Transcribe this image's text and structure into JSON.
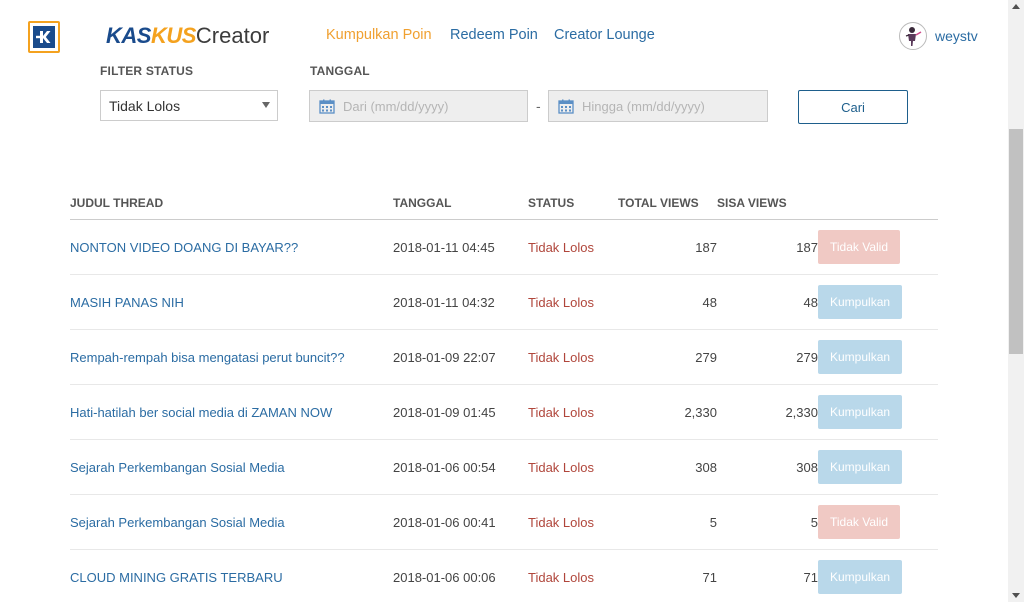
{
  "header": {
    "brand_kas": "KAS",
    "brand_kus": "KUS",
    "brand_creator": "Creator",
    "nav": [
      {
        "label": "Kumpulkan Poin",
        "active": true
      },
      {
        "label": "Redeem Poin",
        "active": false
      },
      {
        "label": "Creator Lounge",
        "active": false
      }
    ],
    "username": "weystv"
  },
  "filter": {
    "status_label": "FILTER STATUS",
    "date_label": "TANGGAL",
    "status_value": "Tidak Lolos",
    "from_placeholder": "Dari (mm/dd/yyyy)",
    "to_placeholder": "Hingga (mm/dd/yyyy)",
    "range_separator": "-",
    "search_label": "Cari"
  },
  "table": {
    "columns": [
      "JUDUL THREAD",
      "TANGGAL",
      "STATUS",
      "TOTAL VIEWS",
      "SISA VIEWS"
    ],
    "rows": [
      {
        "title": "NONTON VIDEO DOANG DI BAYAR??",
        "date": "2018-01-11 04:45",
        "status": "Tidak Lolos",
        "total": "187",
        "sisa": "187",
        "action": "Tidak Valid",
        "action_type": "invalid"
      },
      {
        "title": "MASIH PANAS NIH",
        "date": "2018-01-11 04:32",
        "status": "Tidak Lolos",
        "total": "48",
        "sisa": "48",
        "action": "Kumpulkan",
        "action_type": "collect"
      },
      {
        "title": "Rempah-rempah bisa mengatasi perut buncit??",
        "date": "2018-01-09 22:07",
        "status": "Tidak Lolos",
        "total": "279",
        "sisa": "279",
        "action": "Kumpulkan",
        "action_type": "collect"
      },
      {
        "title": "Hati-hatilah ber social media di ZAMAN NOW",
        "date": "2018-01-09 01:45",
        "status": "Tidak Lolos",
        "total": "2,330",
        "sisa": "2,330",
        "action": "Kumpulkan",
        "action_type": "collect"
      },
      {
        "title": "Sejarah Perkembangan Sosial Media",
        "date": "2018-01-06 00:54",
        "status": "Tidak Lolos",
        "total": "308",
        "sisa": "308",
        "action": "Kumpulkan",
        "action_type": "collect"
      },
      {
        "title": "Sejarah Perkembangan Sosial Media",
        "date": "2018-01-06 00:41",
        "status": "Tidak Lolos",
        "total": "5",
        "sisa": "5",
        "action": "Tidak Valid",
        "action_type": "invalid"
      },
      {
        "title": "CLOUD MINING GRATIS TERBARU",
        "date": "2018-01-06 00:06",
        "status": "Tidak Lolos",
        "total": "71",
        "sisa": "71",
        "action": "Kumpulkan",
        "action_type": "collect"
      }
    ]
  },
  "colors": {
    "brand_blue": "#1a4b8c",
    "brand_orange": "#f4a21f",
    "link": "#2b6ca3",
    "status_red": "#b0463b",
    "btn_invalid": "#f0c9c4",
    "btn_collect": "#b9d8ea"
  },
  "icons": {
    "logo": "kaskus-k-logo",
    "calendar": "calendar-icon",
    "select_caret": "caret-down-icon"
  }
}
